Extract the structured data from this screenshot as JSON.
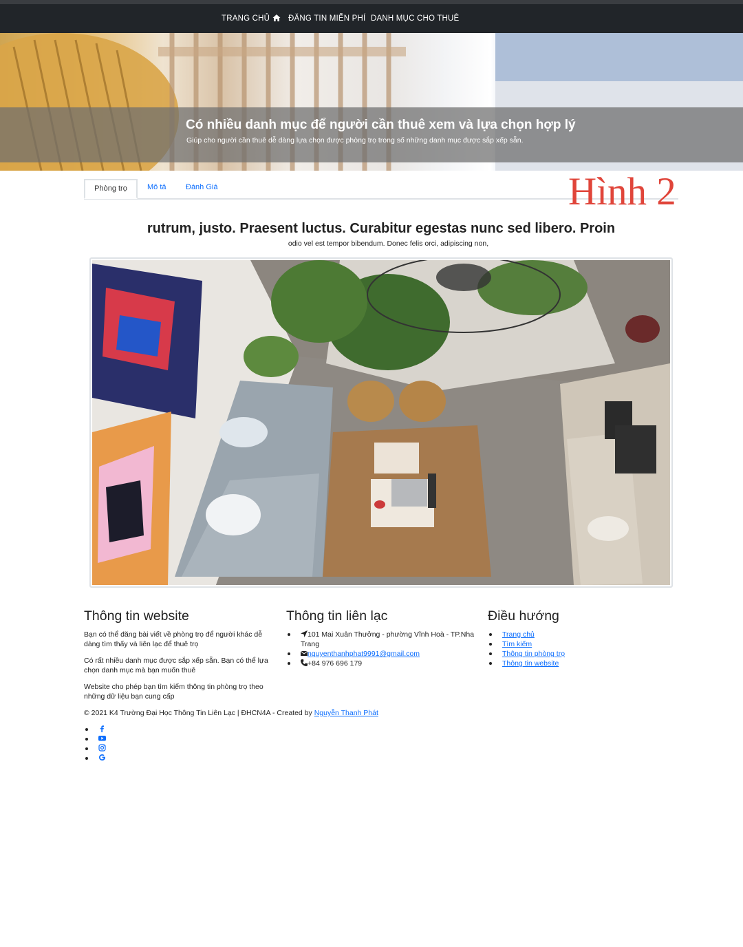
{
  "nav": {
    "home_label": "TRANG CHỦ",
    "post_label": "ĐĂNG TIN MIỄN PHÍ",
    "category_label": "DANH MỤC CHO THUÊ"
  },
  "hero": {
    "title": "Có nhiều danh mục để người cần thuê xem và lựa chọn hợp lý",
    "subtitle": "Giúp cho người cần thuê dễ dàng lựa chọn được phòng trọ trong số những danh mục được sắp xếp sẵn."
  },
  "tabs": [
    {
      "label": "Phòng trọ",
      "active": true
    },
    {
      "label": "Mô tả",
      "active": false
    },
    {
      "label": "Đánh Giá",
      "active": false
    }
  ],
  "watermark": "Hình 2",
  "content": {
    "headline": "rutrum, justo. Praesent luctus. Curabitur egestas nunc sed libero. Proin",
    "subline": "odio vel est tempor bibendum. Donec felis orci, adipiscing non,"
  },
  "footer": {
    "website": {
      "heading": "Thông tin website",
      "paragraphs": [
        "Bạn có thể đăng bài viết về phòng trọ để người khác dễ dàng tìm thấy và liên lạc để thuê trọ",
        "Có rất nhiều danh mục được sắp xếp sẵn. Bạn có thể lựa chọn danh mục mà bạn muốn thuê",
        "Website cho phép bạn tìm kiếm thông tin phòng trọ theo những dữ liệu bạn cung cấp"
      ]
    },
    "contact": {
      "heading": "Thông tin liên lạc",
      "address": "101 Mai Xuân Thưởng - phường Vĩnh Hoà - TP.Nha Trang",
      "email": "nguyenthanhphat9991@gmail.com",
      "phone": "+84 976 696 179"
    },
    "navigation": {
      "heading": "Điều hướng",
      "links": [
        "Trang chủ",
        "Tìm kiếm",
        "Thông tin phòng trọ",
        "Thông tin website"
      ]
    },
    "copyright_text": "© 2021 K4 Trường Đại Học Thông Tin Liên Lạc | ĐHCN4A - Created by ",
    "author": "Nguyễn Thanh Phát",
    "social_icons": [
      "facebook-icon",
      "youtube-icon",
      "instagram-icon",
      "google-icon"
    ]
  },
  "colors": {
    "navbar": "#212529",
    "link": "#0d6efd",
    "watermark": "#e0453a",
    "hero_band": "#6e6e6e"
  }
}
